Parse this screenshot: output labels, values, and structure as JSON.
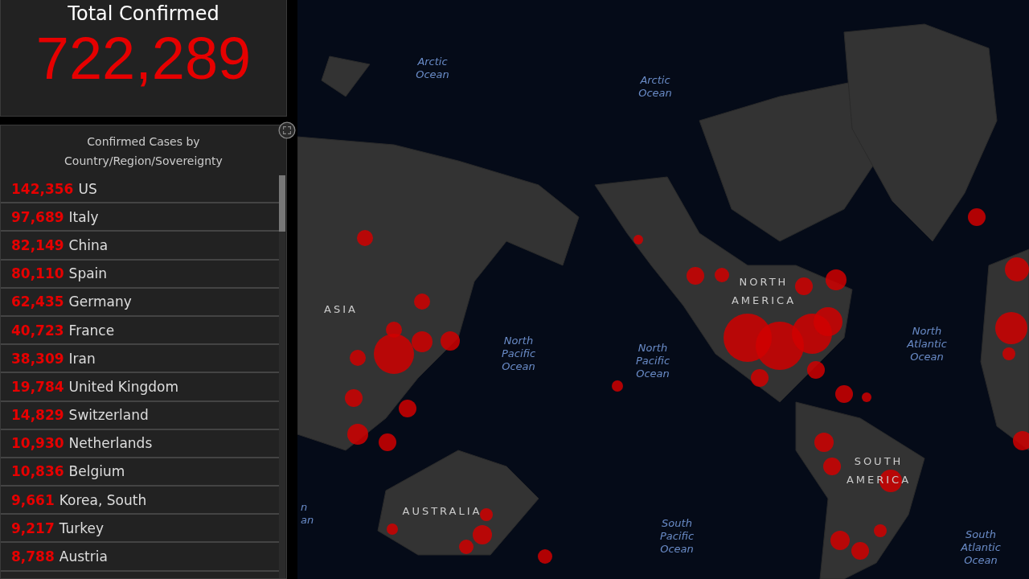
{
  "total": {
    "title": "Total Confirmed",
    "value": "722,289"
  },
  "list": {
    "title": "Confirmed Cases by Country/Region/Sovereignty",
    "rows": [
      {
        "count": "142,356",
        "name": "US"
      },
      {
        "count": "97,689",
        "name": "Italy"
      },
      {
        "count": "82,149",
        "name": "China"
      },
      {
        "count": "80,110",
        "name": "Spain"
      },
      {
        "count": "62,435",
        "name": "Germany"
      },
      {
        "count": "40,723",
        "name": "France"
      },
      {
        "count": "38,309",
        "name": "Iran"
      },
      {
        "count": "19,784",
        "name": "United Kingdom"
      },
      {
        "count": "14,829",
        "name": "Switzerland"
      },
      {
        "count": "10,930",
        "name": "Netherlands"
      },
      {
        "count": "10,836",
        "name": "Belgium"
      },
      {
        "count": "9,661",
        "name": "Korea, South"
      },
      {
        "count": "9,217",
        "name": "Turkey"
      },
      {
        "count": "8,788",
        "name": "Austria"
      }
    ]
  },
  "map": {
    "labels": [
      {
        "kind": "ocean",
        "lines": [
          "Arctic",
          "Ocean"
        ]
      },
      {
        "kind": "ocean",
        "lines": [
          "Arctic",
          "Ocean"
        ]
      },
      {
        "kind": "ocean",
        "lines": [
          "North",
          "Pacific",
          "Ocean"
        ]
      },
      {
        "kind": "ocean",
        "lines": [
          "North",
          "Pacific",
          "Ocean"
        ]
      },
      {
        "kind": "ocean",
        "lines": [
          "North",
          "Atlantic",
          "Ocean"
        ]
      },
      {
        "kind": "ocean",
        "lines": [
          "South",
          "Pacific",
          "Ocean"
        ]
      },
      {
        "kind": "ocean",
        "lines": [
          "South",
          "Atlantic",
          "Ocean"
        ]
      },
      {
        "kind": "ocean",
        "lines": [
          "n",
          "an"
        ]
      },
      {
        "kind": "continent",
        "lines": [
          "ASIA"
        ]
      },
      {
        "kind": "continent",
        "lines": [
          "NORTH",
          "AMERICA"
        ]
      },
      {
        "kind": "continent",
        "lines": [
          "SOUTH",
          "AMERICA"
        ]
      },
      {
        "kind": "continent",
        "lines": [
          "AUSTRALIA"
        ]
      }
    ]
  }
}
